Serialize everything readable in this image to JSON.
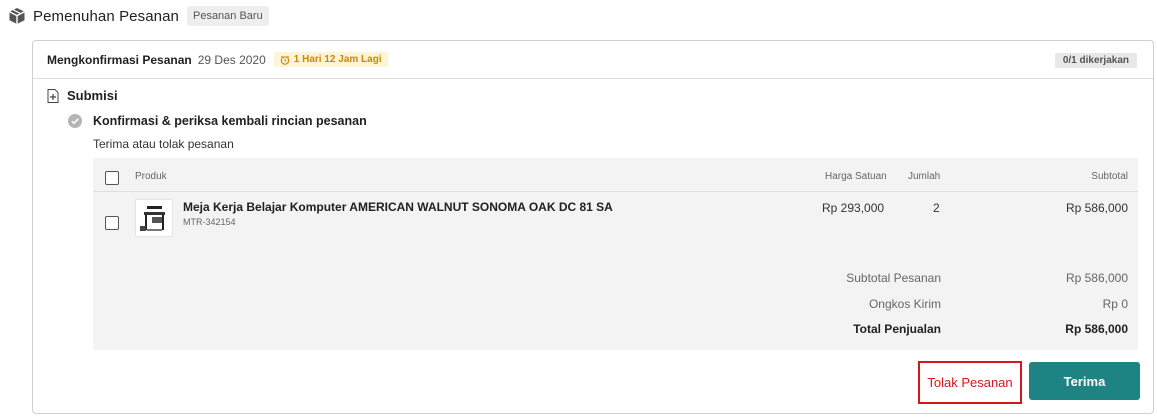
{
  "header": {
    "title": "Pemenuhan Pesanan",
    "status_tag": "Pesanan Baru"
  },
  "card": {
    "label": "Mengkonfirmasi Pesanan",
    "date": "29 Des 2020",
    "deadline": "1 Hari 12 Jam Lagi",
    "progress": "0/1 dikerjakan"
  },
  "submission": {
    "title": "Submisi",
    "step_title": "Konfirmasi & periksa kembali rincian pesanan",
    "step_desc": "Terima atau tolak pesanan"
  },
  "table": {
    "headers": {
      "product": "Produk",
      "unit_price": "Harga Satuan",
      "qty": "Jumlah",
      "subtotal": "Subtotal"
    },
    "rows": [
      {
        "name": "Meja Kerja Belajar Komputer AMERICAN WALNUT SONOMA OAK DC 81 SA",
        "sku": "MTR-342154",
        "unit_price": "Rp 293,000",
        "qty": "2",
        "subtotal": "Rp 586,000"
      }
    ]
  },
  "summary": {
    "subtotal_label": "Subtotal Pesanan",
    "subtotal_value": "Rp 586,000",
    "shipping_label": "Ongkos Kirim",
    "shipping_value": "Rp 0",
    "total_label": "Total Penjualan",
    "total_value": "Rp 586,000"
  },
  "actions": {
    "reject_label": "Tolak Pesanan",
    "accept_label": "Terima"
  },
  "colors": {
    "accent": "#1e8383",
    "reject": "#d6161c",
    "deadline_bg": "#fff4d6",
    "deadline_text": "#c98a00"
  },
  "icons": {
    "header": "box-icon",
    "deadline": "clock-icon",
    "submission": "document-add-icon",
    "step": "check-circle-icon"
  }
}
